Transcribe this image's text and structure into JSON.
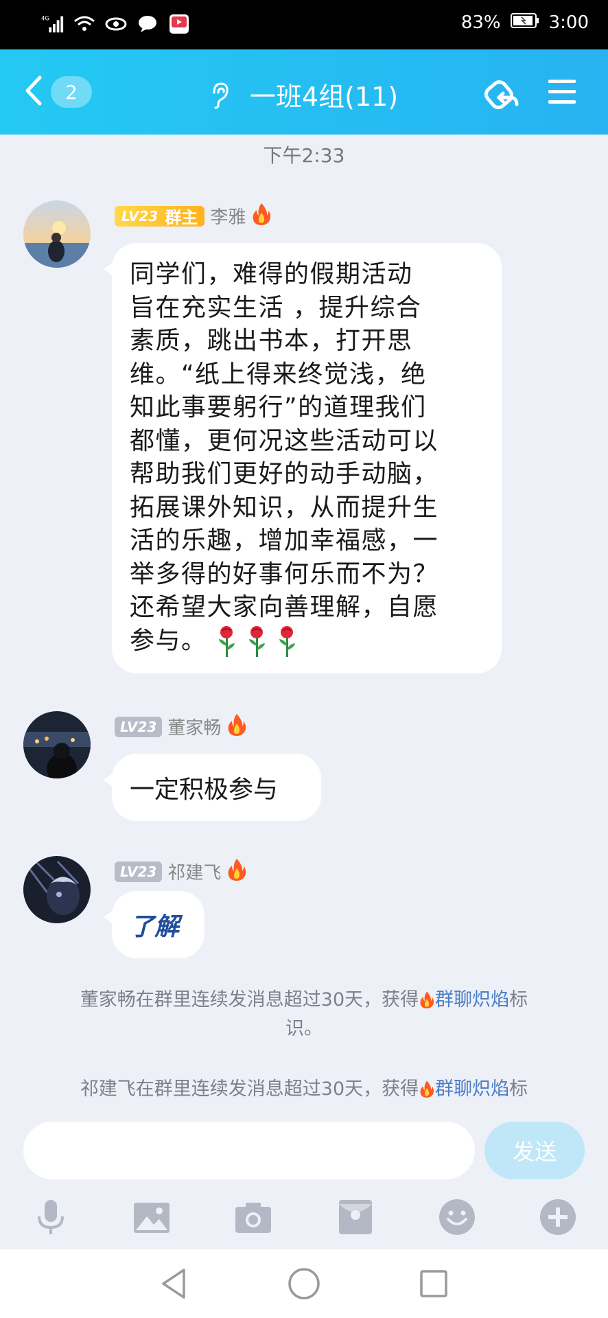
{
  "status_bar": {
    "network": "4G",
    "battery": "83%",
    "time": "3:00"
  },
  "header": {
    "unread_badge": "2",
    "title": "一班4组(11)"
  },
  "timestamp": "下午2:33",
  "messages": [
    {
      "level": "LV23",
      "role": "群主",
      "name": "李雅",
      "lines": [
        "同学们，难得的假期活动",
        "旨在充实生活 ，提升综合",
        "素质，跳出书本，打开思",
        "维。“纸上得来终觉浅，绝",
        "知此事要躬行”的道理我们",
        "都懂，更何况这些活动可以",
        "帮助我们更好的动手动脑，",
        "拓展课外知识，从而提升生",
        "活的乐趣，增加幸福感，一",
        "举多得的好事何乐而不为？",
        "还希望大家向善理解，自愿",
        "参与。"
      ]
    },
    {
      "level": "LV23",
      "name": "董家畅",
      "text": "一定积极参与"
    },
    {
      "level": "LV23",
      "name": "祁建飞",
      "text": "了解"
    }
  ],
  "system_notices": [
    {
      "before": "董家畅在群里连续发消息超过30天，获得",
      "highlight": "群聊炽焰",
      "after": "标",
      "line2": "识。"
    },
    {
      "before": "祁建飞在群里连续发消息超过30天，获得",
      "highlight": "群聊炽焰",
      "after": "标"
    }
  ],
  "input": {
    "placeholder": "",
    "send_label": "发送"
  },
  "toolbar_icons": [
    "microphone-icon",
    "image-icon",
    "camera-icon",
    "red-packet-icon",
    "emoji-icon",
    "plus-icon"
  ],
  "colors": {
    "header": "#24c9f3",
    "highlight": "#4a7ec4",
    "owner_badge": "#ffc22b",
    "background": "#eef0f8"
  }
}
